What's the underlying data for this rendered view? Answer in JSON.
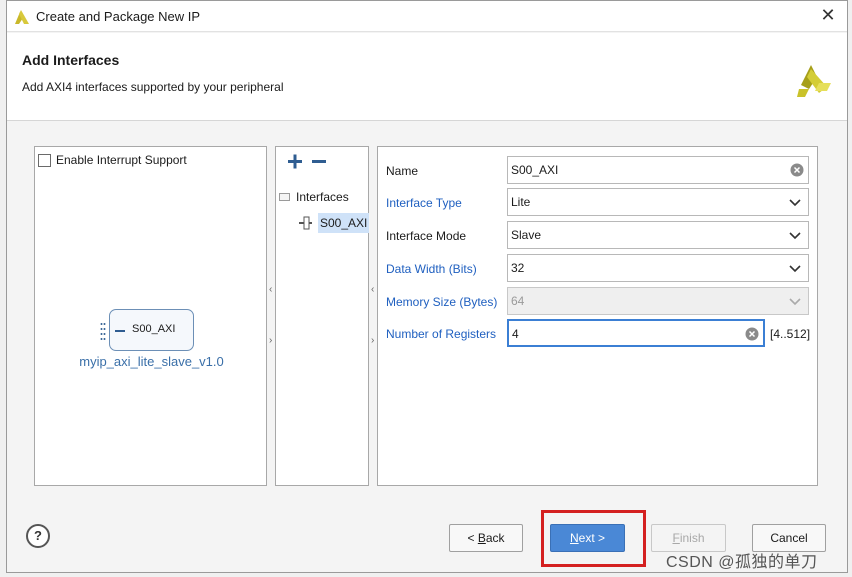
{
  "window": {
    "title": "Create and Package New IP",
    "close_glyph": "✕"
  },
  "header": {
    "title": "Add Interfaces",
    "subtitle": "Add AXI4 interfaces supported by your peripheral"
  },
  "left_panel": {
    "interrupt_label": "Enable Interrupt Support",
    "interrupt_checked": false,
    "ip_port": "S00_AXI",
    "ip_name": "myip_axi_lite_slave_v1.0"
  },
  "mid_panel": {
    "tree_header": "Interfaces",
    "items": [
      {
        "label": "S00_AXI",
        "selected": true
      }
    ]
  },
  "form": {
    "name": {
      "label": "Name",
      "value": "S00_AXI"
    },
    "interface_type": {
      "label": "Interface Type",
      "value": "Lite"
    },
    "interface_mode": {
      "label": "Interface Mode",
      "value": "Slave"
    },
    "data_width": {
      "label": "Data Width (Bits)",
      "value": "32"
    },
    "memory_size": {
      "label": "Memory Size (Bytes)",
      "value": "64"
    },
    "num_registers": {
      "label": "Number of Registers",
      "value": "4",
      "range": "[4..512]"
    }
  },
  "footer": {
    "help": "?",
    "back": {
      "pre": "< ",
      "key": "B",
      "rest": "ack"
    },
    "next": {
      "key": "N",
      "rest": "ext",
      "post": " >"
    },
    "finish": {
      "key": "F",
      "rest": "inish"
    },
    "cancel": "Cancel"
  },
  "watermark": "CSDN @孤独的单刀",
  "colors": {
    "accent": "#4a88d6",
    "label_blue": "#2060c0",
    "highlight": "#d42020",
    "xilinx_yellow": "#b7b315"
  }
}
